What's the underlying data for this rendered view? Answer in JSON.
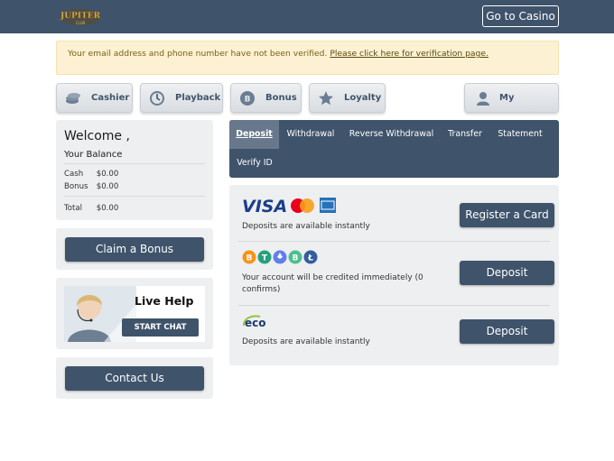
{
  "header": {
    "logo_alt": "casino-logo",
    "go_to_casino": "Go to Casino"
  },
  "notice": {
    "text": "Your email address and phone number have not been verified.",
    "link": "Please click here for verification page."
  },
  "nav": {
    "cashier": "Cashier",
    "playback": "Playback",
    "bonus": "Bonus",
    "loyalty": "Loyalty",
    "my_account": "My Account"
  },
  "welcome": {
    "title": "Welcome ,",
    "balance_label": "Your Balance",
    "cash_label": "Cash",
    "cash_value": "$0.00",
    "bonus_label": "Bonus",
    "bonus_value": "$0.00",
    "total_label": "Total",
    "total_value": "$0.00"
  },
  "claim_bonus": "Claim a Bonus",
  "live_help": {
    "title": "Live Help",
    "start_chat": "START CHAT"
  },
  "contact_us": "Contact Us",
  "tabs": [
    {
      "label": "Deposit"
    },
    {
      "label": "Withdrawal"
    },
    {
      "label": "Reverse Withdrawal"
    },
    {
      "label": "Transfer"
    },
    {
      "label": "Statement"
    },
    {
      "label": "Verify ID"
    }
  ],
  "payments": {
    "cards": {
      "visa_text": "VISA",
      "note": "Deposits are available instantly",
      "button": "Register a Card"
    },
    "crypto": {
      "note_line1": "Your account will be credited immediately (0",
      "note_line2": "confirms)",
      "button": "Deposit"
    },
    "eco": {
      "logo_text": "eco",
      "note": "Deposits are available instantly",
      "button": "Deposit"
    }
  },
  "colors": {
    "header": "#3f536b",
    "tab_active": "#68788c",
    "notice_bg": "#fcf1d2",
    "panel_bg": "#eeeff0"
  }
}
